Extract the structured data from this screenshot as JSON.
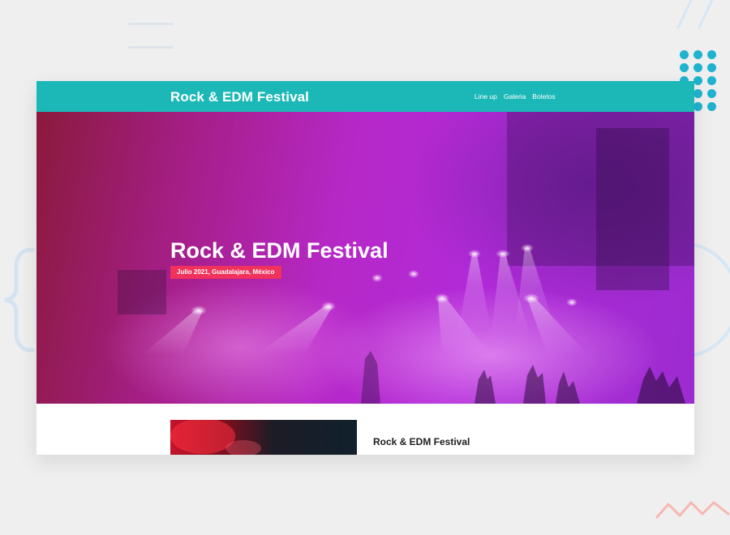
{
  "navbar": {
    "brand": "Rock & EDM Festival",
    "links": [
      "Line up",
      "Galeria",
      "Boletos"
    ]
  },
  "hero": {
    "title": "Rock & EDM Festival",
    "badge": "Julio 2021, Guadalajara, México"
  },
  "content": {
    "title": "Rock & EDM Festival"
  },
  "colors": {
    "navbar": "#1bb8b7",
    "badge": "#f0325c",
    "dots": "#1fb3cf",
    "hero_magenta": "#b628c6"
  },
  "icons": [
    "dots-grid-icon",
    "curly-brace-icon",
    "zigzag-icon",
    "hamburger-lines-icon"
  ]
}
